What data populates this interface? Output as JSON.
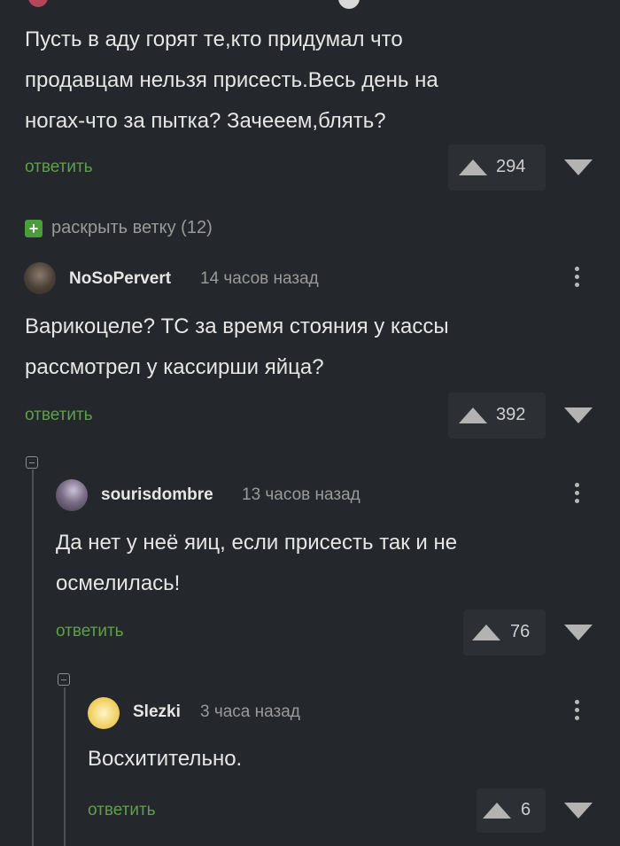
{
  "comments": [
    {
      "body": [
        "Пусть в аду горят те,кто придумал что",
        "продавцам нельзя присесть.Весь день на",
        "ногах-что за пытка? Зачееем,блять?"
      ],
      "reply_label": "ответить",
      "score": "294"
    },
    {
      "username": "NoSoPervert",
      "timestamp": "14 часов назад",
      "body": [
        "Варикоцеле? ТС за время стояния у кассы",
        "рассмотрел у кассирши яйца?"
      ],
      "reply_label": "ответить",
      "score": "392"
    },
    {
      "username": "sourisdombre",
      "timestamp": "13 часов назад",
      "body": [
        "Да нет у неё яиц, если присесть так и не",
        "осмелилась!"
      ],
      "reply_label": "ответить",
      "score": "76"
    },
    {
      "username": "Slezki",
      "timestamp": "3 часа назад",
      "body": [
        "Восхитительно."
      ],
      "reply_label": "ответить",
      "score": "6"
    }
  ],
  "expand_thread": {
    "label": "раскрыть ветку (12)"
  },
  "colors": {
    "background": "#24272b",
    "reply_green": "#5f9f4a",
    "expand_green": "#4b9c3a"
  }
}
